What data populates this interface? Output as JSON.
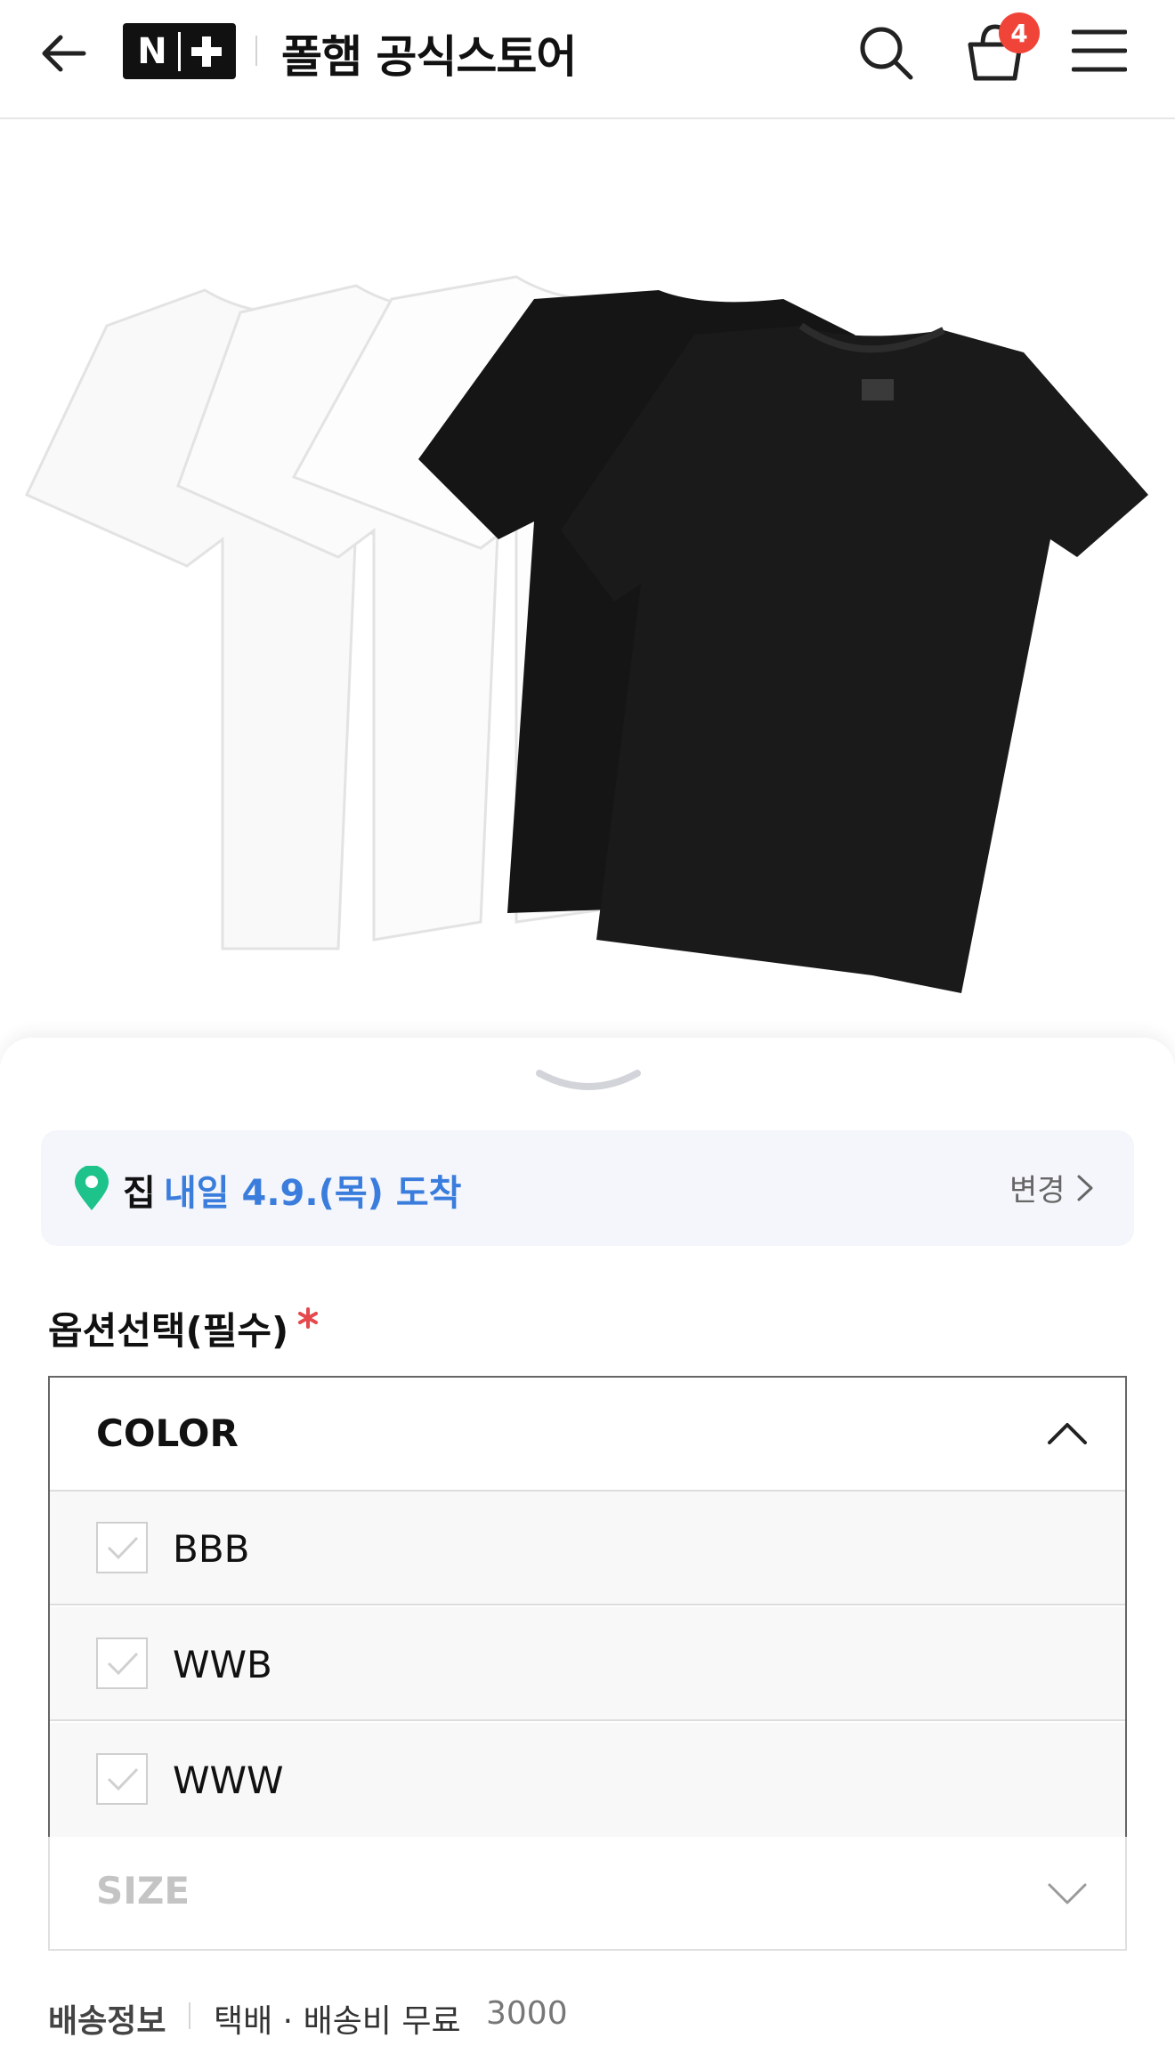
{
  "header": {
    "back_icon": "arrow-left-icon",
    "brand_badge": "N+",
    "store_title": "폴햄 공식스토어",
    "search_icon": "search-icon",
    "cart_icon": "shopping-bag-icon",
    "cart_count": "4",
    "menu_icon": "hamburger-menu-icon"
  },
  "product": {
    "image": "product-photo-tshirts",
    "colors": [
      "#ffffff",
      "#111111"
    ]
  },
  "sheet": {
    "handle_icon": "chevron-down-handle-icon"
  },
  "delivery": {
    "pin_icon": "location-pin-icon",
    "location": "집",
    "eta": "내일 4.9.(목) 도착",
    "change_label": "변경",
    "accent": "#3b7ddd",
    "pin_color": "#1ec28b"
  },
  "options": {
    "title": "옵션선택(필수)",
    "required_mark_color": "#e5484d",
    "color_group": {
      "label": "COLOR",
      "items": [
        "BBB",
        "WWB",
        "WWW"
      ]
    },
    "size_group": {
      "label": "SIZE"
    }
  },
  "shipping": {
    "label": "배송정보",
    "method": "택배 · 배송비 무료",
    "amount": "3000"
  }
}
